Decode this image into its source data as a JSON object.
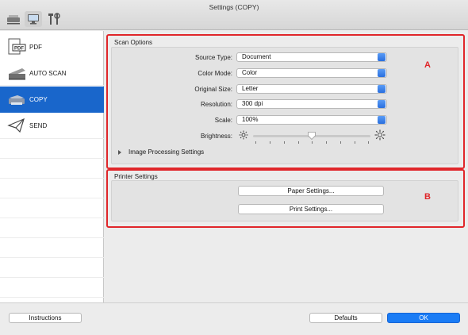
{
  "window": {
    "title": "Settings (COPY)"
  },
  "toolbar": {
    "icons": [
      "scanner-icon",
      "computer-monitor-icon",
      "tools-icon"
    ]
  },
  "sidebar": {
    "items": [
      {
        "label": "PDF",
        "icon": "pdf-document-icon"
      },
      {
        "label": "AUTO SCAN",
        "icon": "scanner-icon"
      },
      {
        "label": "COPY",
        "icon": "printer-icon",
        "selected": true
      },
      {
        "label": "SEND",
        "icon": "paper-plane-icon"
      }
    ]
  },
  "scan_options": {
    "title": "Scan Options",
    "marker": "A",
    "source_type": {
      "label": "Source Type:",
      "value": "Document"
    },
    "color_mode": {
      "label": "Color Mode:",
      "value": "Color"
    },
    "original_size": {
      "label": "Original Size:",
      "value": "Letter"
    },
    "resolution": {
      "label": "Resolution:",
      "value": "300 dpi"
    },
    "scale": {
      "label": "Scale:",
      "value": "100%"
    },
    "brightness": {
      "label": "Brightness:",
      "level": 0.5
    },
    "image_processing": {
      "label": "Image Processing Settings"
    }
  },
  "printer_settings": {
    "title": "Printer Settings",
    "marker": "B",
    "paper_button": "Paper Settings...",
    "print_button": "Print Settings..."
  },
  "footer": {
    "instructions": "Instructions",
    "defaults": "Defaults",
    "ok": "OK"
  },
  "colors": {
    "accent": "#1966cb",
    "ok_button": "#1a7cf5",
    "highlight_box": "#e0262a"
  }
}
